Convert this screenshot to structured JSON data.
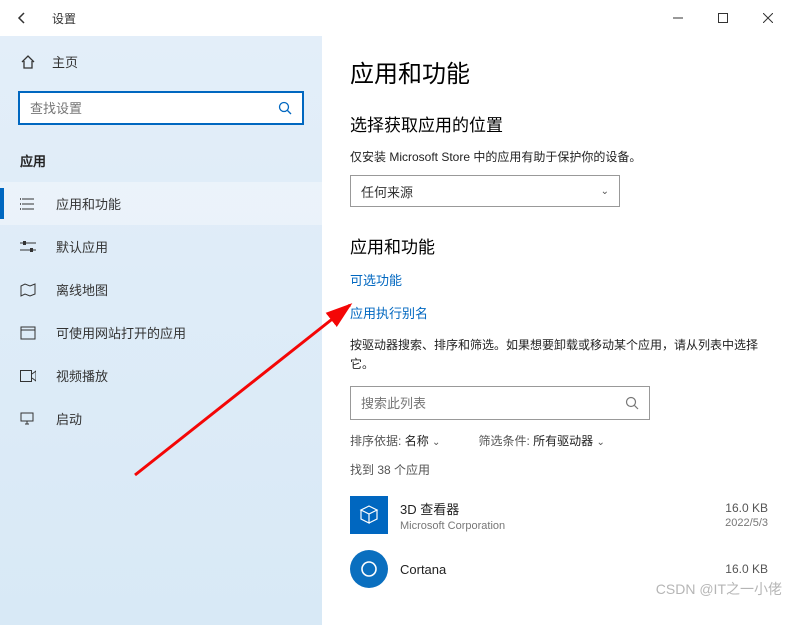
{
  "titlebar": {
    "title": "设置"
  },
  "sidebar": {
    "home": "主页",
    "search_placeholder": "查找设置",
    "category": "应用",
    "items": [
      {
        "label": "应用和功能"
      },
      {
        "label": "默认应用"
      },
      {
        "label": "离线地图"
      },
      {
        "label": "可使用网站打开的应用"
      },
      {
        "label": "视频播放"
      },
      {
        "label": "启动"
      }
    ]
  },
  "main": {
    "title": "应用和功能",
    "source_heading": "选择获取应用的位置",
    "source_desc": "仅安装 Microsoft Store 中的应用有助于保护你的设备。",
    "source_value": "任何来源",
    "section_heading": "应用和功能",
    "link_optional": "可选功能",
    "link_alias": "应用执行别名",
    "list_hint": "按驱动器搜索、排序和筛选。如果想要卸载或移动某个应用，请从列表中选择它。",
    "list_search_placeholder": "搜索此列表",
    "sort_label": "排序依据:",
    "sort_value": "名称",
    "filter_label": "筛选条件:",
    "filter_value": "所有驱动器",
    "found_text": "找到 38 个应用",
    "apps": [
      {
        "name": "3D 查看器",
        "publisher": "Microsoft Corporation",
        "size": "16.0 KB",
        "date": "2022/5/3"
      },
      {
        "name": "Cortana",
        "publisher": "",
        "size": "16.0 KB",
        "date": ""
      }
    ]
  },
  "watermark": "CSDN @IT之一小佬"
}
